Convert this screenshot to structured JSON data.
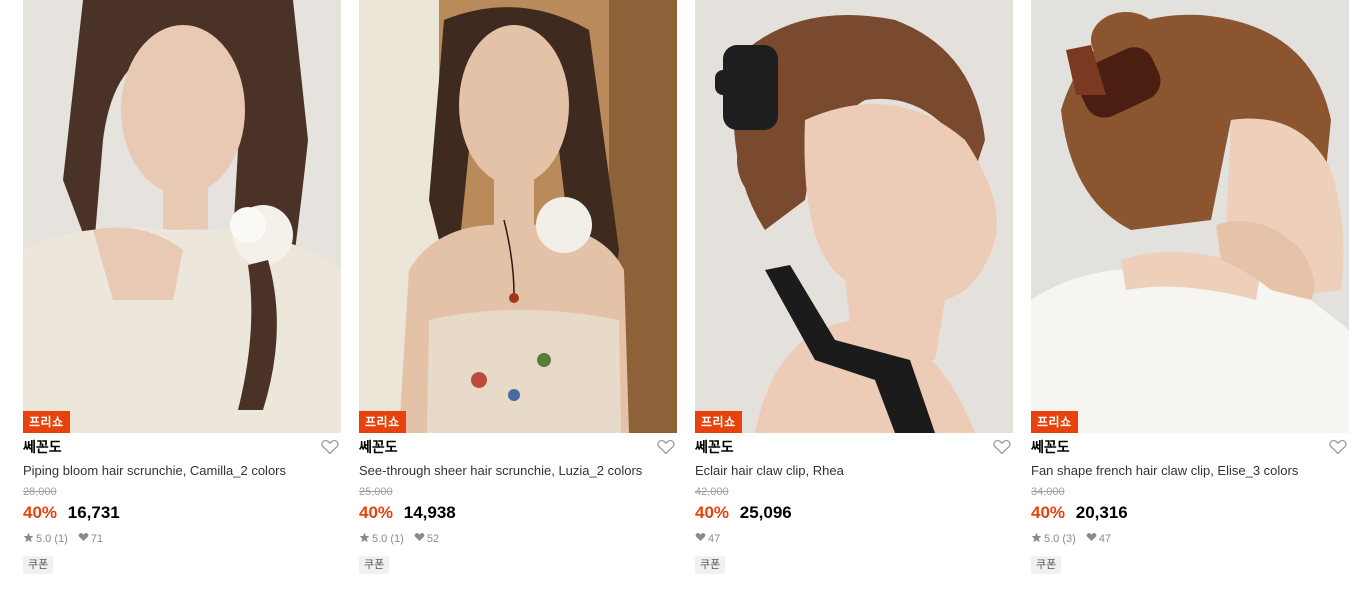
{
  "products": [
    {
      "badge": "프리쇼",
      "brand": "쎄꼰도",
      "name": "Piping bloom hair scrunchie, Camilla_2 colors",
      "original_price": "28,000",
      "discount": "40%",
      "price": "16,731",
      "rating": "5.0",
      "reviews": "(1)",
      "likes": "71",
      "coupon": "쿠폰",
      "photo": {
        "bg": "#e6e3de",
        "hair": "#4a3226",
        "skin": "#e8c9b4",
        "cloth": "#ede6da",
        "accessory": "#f4f1ea"
      }
    },
    {
      "badge": "프리쇼",
      "brand": "쎄꼰도",
      "name": "See-through sheer hair scrunchie, Luzia_2 colors",
      "original_price": "25,000",
      "discount": "40%",
      "price": "14,938",
      "rating": "5.0",
      "reviews": "(1)",
      "likes": "52",
      "coupon": "쿠폰",
      "photo": {
        "bg": "#b98a5a",
        "hair": "#3f2a1f",
        "skin": "#e4c2a8",
        "cloth": "#e7dac8",
        "accessory": "#f2efe8"
      }
    },
    {
      "badge": "프리쇼",
      "brand": "쎄꼰도",
      "name": "Eclair hair claw clip, Rhea",
      "original_price": "42,000",
      "discount": "40%",
      "price": "25,096",
      "rating": "",
      "reviews": "",
      "likes": "47",
      "coupon": "쿠폰",
      "photo": {
        "bg": "#e4e1dc",
        "hair": "#7a4a2e",
        "skin": "#ecccb6",
        "cloth": "#1b1b1b",
        "accessory": "#1e1e1e"
      }
    },
    {
      "badge": "프리쇼",
      "brand": "쎄꼰도",
      "name": "Fan shape french hair claw clip, Elise_3 colors",
      "original_price": "34,000",
      "discount": "40%",
      "price": "20,316",
      "rating": "5.0",
      "reviews": "(3)",
      "likes": "47",
      "coupon": "쿠폰",
      "photo": {
        "bg": "#e3e1de",
        "hair": "#8a552f",
        "skin": "#eecfb9",
        "cloth": "#f6f5f2",
        "accessory": "#4a1f12"
      }
    }
  ]
}
